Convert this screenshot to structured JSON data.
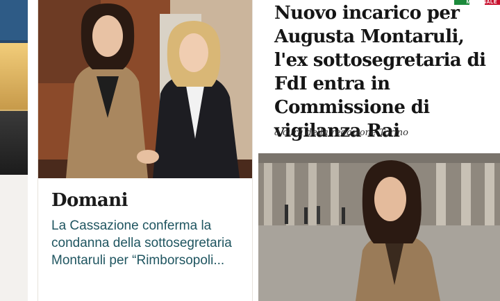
{
  "left_card": {
    "photo_icon": "photo-image"
  },
  "domani_card": {
    "brand": "Domani",
    "headline": "La Cassazione conferma la condanna della sottosegretaria Montaruli per “Rimborsopoli...",
    "photo_icon": "handshake-photo"
  },
  "article": {
    "badge": "MATTINALE",
    "title": "Nuovo incarico per Augusta Montaruli, l'ex sottosegretaria di FdI entra in Commissione di vigilanza Rai",
    "byline": "a cura della redazione Torino",
    "photo_icon": "portrait-photo"
  },
  "colors": {
    "headline_teal": "#1f5560",
    "flag_green": "#1b8a3b",
    "flag_white": "#ffffff",
    "flag_red": "#c8102e"
  }
}
